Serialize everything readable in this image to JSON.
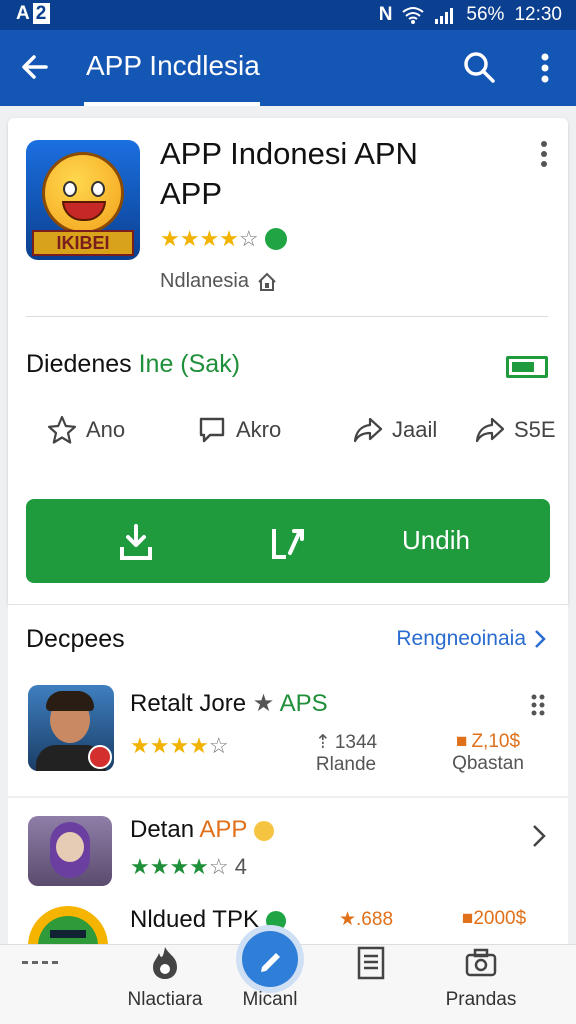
{
  "status_bar": {
    "left_text": "A",
    "left_badge": "2",
    "nfc": "N",
    "battery_pct": "56%",
    "time": "12:30"
  },
  "app_bar": {
    "title": "APP Incdlesia"
  },
  "app": {
    "name_line1": "APP Indonesi APN",
    "name_line2": "APP",
    "stars_filled": "★★★★",
    "stars_empty": "☆",
    "developer": "Ndlanesia",
    "icon_banner": "IKIBEI",
    "downloads_label": "Diedenes",
    "downloads_value": "Ine (Sak)"
  },
  "actions": [
    {
      "label": "Ano"
    },
    {
      "label": "Akro"
    },
    {
      "label": "Jaail"
    },
    {
      "label": "S5E"
    }
  ],
  "install_button": {
    "label": "Undih"
  },
  "section": {
    "title": "Decpees",
    "link": "Rengneoinaia"
  },
  "list": [
    {
      "title": "Retalt Jore",
      "tag": "APS",
      "stars_filled": "★★★★",
      "stars_empty": "☆",
      "stat1_value": "1344",
      "stat1_label": "Rlande",
      "stat2_value": "Z,10$",
      "stat2_label": "Qbastan"
    },
    {
      "title": "Detan",
      "tag": "APP",
      "stars_filled": "★★★★",
      "stars_empty": "☆",
      "rating_count": "4"
    },
    {
      "title": "Nldued TPK",
      "stat1_value": ".688",
      "stat2_value": "2000$"
    }
  ],
  "bottom_nav": [
    {
      "label": "Nlactiara"
    },
    {
      "label": "Micanl"
    },
    {
      "label": ""
    },
    {
      "label": "Prandas"
    }
  ],
  "colors": {
    "status_bar": "#0b3f8f",
    "app_bar": "#1456b4",
    "install_green": "#1f9a3d",
    "star_yellow": "#f2b300",
    "link_blue": "#2a6ccf",
    "accent_orange": "#e0701a"
  }
}
